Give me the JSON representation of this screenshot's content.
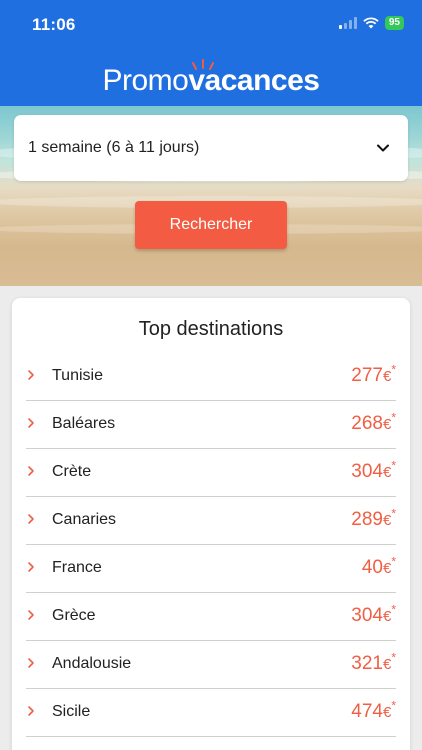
{
  "status_bar": {
    "time": "11:06",
    "battery": "95"
  },
  "logo": {
    "part1": "Promo",
    "part2": "vacances"
  },
  "search": {
    "duration_value": "1 semaine (6 à 11 jours)",
    "button_label": "Rechercher"
  },
  "top": {
    "title": "Top destinations",
    "currency": "€",
    "asterisk": "*",
    "destinations": [
      {
        "name": "Tunisie",
        "price": "277"
      },
      {
        "name": "Baléares",
        "price": "268"
      },
      {
        "name": "Crète",
        "price": "304"
      },
      {
        "name": "Canaries",
        "price": "289"
      },
      {
        "name": "France",
        "price": "40"
      },
      {
        "name": "Grèce",
        "price": "304"
      },
      {
        "name": "Andalousie",
        "price": "321"
      },
      {
        "name": "Sicile",
        "price": "474"
      }
    ]
  },
  "colors": {
    "header_blue": "#1f6fe0",
    "accent_orange": "#f35c43",
    "price_orange": "#f05e43"
  }
}
